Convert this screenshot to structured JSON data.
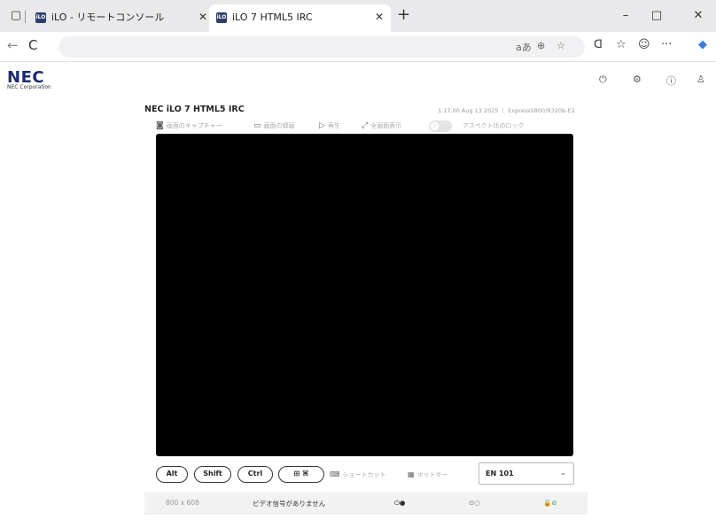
{
  "browser": {
    "tabs": [
      {
        "label": "iLO - リモートコンソール",
        "favicon": "iLO",
        "active": false
      },
      {
        "label": "iLO 7 HTML5 IRC",
        "favicon": "iLO",
        "active": true
      }
    ],
    "window_controls": {
      "minimize": "–",
      "maximize": "□",
      "close": "✕"
    },
    "tab_close": "✕",
    "new_tab": "+",
    "nav": {
      "back": "←",
      "reload": "C"
    },
    "address_icons": {
      "read_aloud": "aあ",
      "zoom": "⊕",
      "favorite": "☆"
    }
  },
  "header": {
    "logo": "NEC",
    "corporation": "NEC Corporation",
    "icons": [
      "power-icon",
      "settings-icon",
      "info-icon",
      "user-icon"
    ]
  },
  "console": {
    "title": "NEC iLO 7 HTML5 IRC",
    "version": "1.17.00 Aug 13 2025 ｜ Express5800/R320b-E2",
    "actions": {
      "capture": "画面のキャプチャー",
      "record": "画面の録画",
      "play": "再生",
      "fullscreen": "全画面表示",
      "aspect_lock": "アスペクト比のロック"
    },
    "keys": {
      "alt": "Alt",
      "shift": "Shift",
      "ctrl": "Ctrl",
      "win": "⊞ ⌘"
    },
    "shortcut": "ショートカット",
    "hotkey": "ホットキー",
    "keyboard_layout": "EN 101",
    "status": {
      "resolution": "800 x 608",
      "message": "ビデオ信号がありません",
      "power": "⏻●",
      "media": "⊙○",
      "security": "🔒⊘"
    }
  }
}
